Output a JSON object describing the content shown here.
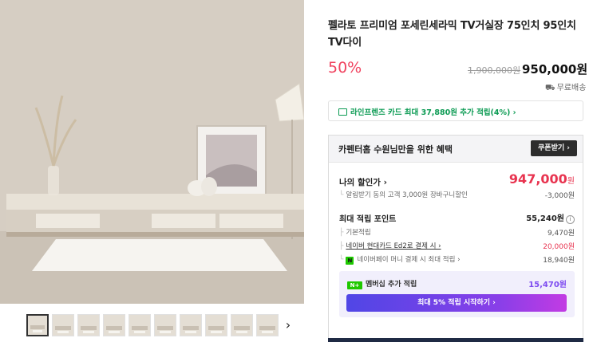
{
  "product": {
    "title": "펠라토 프리미엄 포세린세라믹 TV거실장 75인치 95인치 TV다이",
    "discount": "50%",
    "original_price": "1,900,000원",
    "sale_price": "950,000원",
    "shipping": "무료배송"
  },
  "card_banner": {
    "text": "라인프렌즈 카드 최대 37,880원 추가 적립(4%) ›"
  },
  "benefits": {
    "title": "카펜터홈 수원님만을 위한 혜택",
    "coupon_button": "쿠폰받기 ›",
    "my_price_label": "나의 할인가 ›",
    "my_price_value": "947,000",
    "my_price_unit": "원",
    "alarm_label": "알림받기 동의 고객 3,000원 장바구니할인",
    "alarm_value": "-3,000원",
    "points_label": "최대 적립 포인트",
    "points_value": "55,240원",
    "points_info": "i",
    "basic_label": "기본적립",
    "basic_value": "9,470원",
    "hyundai_label": "네이버 현대카드 Ed2로 결제 시 ›",
    "hyundai_value": "20,000원",
    "npay_icon": "N",
    "npay_label": "네이버페이 머니 결제 시 최대 적립 ›",
    "npay_value": "18,940원",
    "member_icon": "N+",
    "member_label": "멤버십 추가 적립",
    "member_value": "15,470원",
    "member_button": "최대 5% 적립 시작하기 ›"
  },
  "gallery": {
    "thumb_count": 10,
    "selected_index": 0,
    "next_icon": "›"
  },
  "colors": {
    "discount": "#f0435f",
    "price_red": "#e8334f",
    "card_green": "#0a9a52",
    "naver_green": "#1ec800",
    "member_purple": "#7d4bf0"
  }
}
